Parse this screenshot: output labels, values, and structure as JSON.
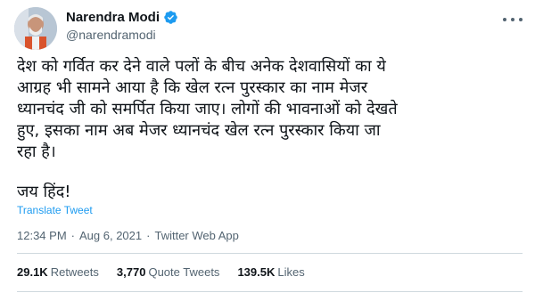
{
  "author": {
    "display_name": "Narendra Modi",
    "handle": "@narendramodi",
    "verified": true
  },
  "tweet": {
    "text": "देश को गर्वित कर देने वाले पलों के बीच अनेक देशवासियों का ये\nआग्रह भी सामने आया है कि खेल रत्न पुरस्कार का नाम मेजर\nध्यानचंद जी को समर्पित किया जाए। लोगों की भावनाओं को देखते\nहुए, इसका नाम अब मेजर ध्यानचंद खेल रत्न पुरस्कार किया जा\nरहा है।",
    "sign_off": "जय हिंद!",
    "translate_label": "Translate Tweet"
  },
  "meta": {
    "time": "12:34 PM",
    "date": "Aug 6, 2021",
    "separator": "·",
    "source": "Twitter Web App"
  },
  "stats": {
    "retweets_count": "29.1K",
    "retweets_label": "Retweets",
    "quotes_count": "3,770",
    "quotes_label": "Quote Tweets",
    "likes_count": "139.5K",
    "likes_label": "Likes"
  },
  "colors": {
    "link": "#1d9bf0",
    "secondary_text": "#536471",
    "divider": "#cfd9de"
  }
}
